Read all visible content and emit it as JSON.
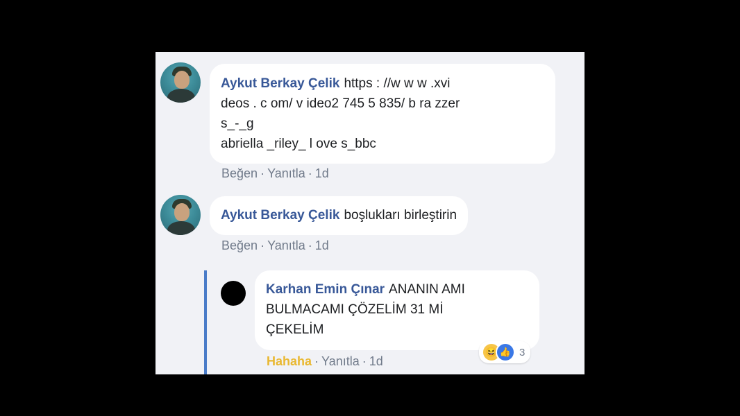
{
  "comments": [
    {
      "author": "Aykut Berkay Çelik",
      "lines": [
        "https : //w w w .xvi",
        "deos . c om/ v ideo2 745 5 835/ b ra zzer",
        "s_-_g",
        "abriella _riley_ l ove s_bbc"
      ],
      "actions": {
        "like": "Beğen",
        "reply": "Yanıtla",
        "time": "1d"
      }
    },
    {
      "author": "Aykut Berkay Çelik",
      "text": "boşlukları birleştirin",
      "actions": {
        "like": "Beğen",
        "reply": "Yanıtla",
        "time": "1d"
      }
    }
  ],
  "reply": {
    "author": "Karhan Emin Çınar",
    "lines": [
      "ANANIN AMI",
      "BULMACAMI ÇÖZELİM 31 Mİ",
      "ÇEKELİM"
    ],
    "actions": {
      "reaction": "Hahaha",
      "reply": "Yanıtla",
      "time": "1d"
    },
    "reactions": {
      "icons": [
        "haha-icon",
        "like-icon"
      ],
      "count": "3"
    }
  },
  "separator": "·",
  "colors": {
    "name": "#385898",
    "hahaha": "#e9b830",
    "thread_line": "#4a7cc8"
  }
}
